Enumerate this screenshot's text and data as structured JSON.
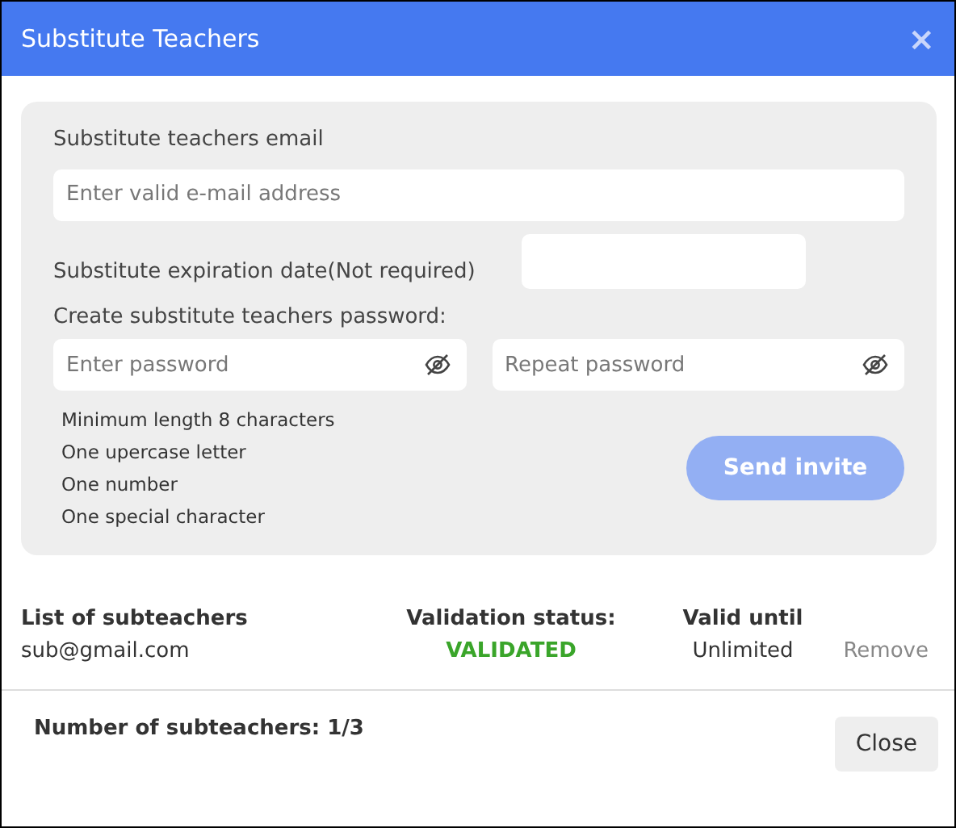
{
  "window": {
    "title": "Substitute Teachers",
    "close": "×"
  },
  "form": {
    "email_label": "Substitute teachers email",
    "email_placeholder": "Enter valid e-mail address",
    "date_label": "Substitute expiration date(Not required)",
    "password_label": "Create substitute teachers password:",
    "password_fields": [
      {
        "placeholder": "Enter password"
      },
      {
        "placeholder": "Repeat password"
      }
    ],
    "requirements": [
      "Minimum length 8 characters",
      "One upercase letter",
      "One number",
      "One special character"
    ],
    "send_button": {
      "label": "Send invite",
      "disabled": true
    }
  },
  "list": {
    "columns": [
      "List of subteachers",
      "Validation status:",
      "Valid until"
    ],
    "rows": [
      {
        "email": "sub@gmail.com",
        "status": "VALIDATED",
        "color": "#3aa52a",
        "valid_until": "Unlimited",
        "action": "Remove"
      }
    ]
  },
  "footer": {
    "count": "Number of subteachers: 1/3",
    "close_button": "Close"
  }
}
